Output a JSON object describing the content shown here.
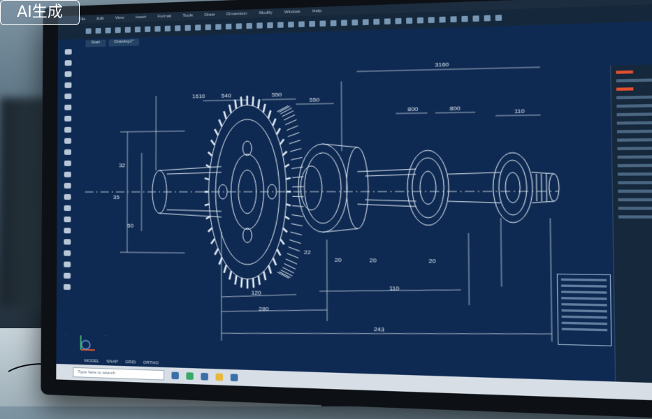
{
  "watermark": {
    "text": "AI生成"
  },
  "cad": {
    "menu": [
      "File",
      "Edit",
      "View",
      "Insert",
      "Format",
      "Tools",
      "Draw",
      "Dimension",
      "Modify",
      "Window",
      "Help"
    ],
    "tabs": [
      "Start",
      "Drawing1*"
    ],
    "taskbar_search_placeholder": "Type here to search",
    "status": [
      "MODEL",
      "SNAP",
      "GRID",
      "ORTHO"
    ],
    "dimensions": {
      "top_total": "3160",
      "gear_left_a": "1610",
      "gear_left_b": "540",
      "gear_mid": "550",
      "gear_right": "550",
      "mid_1": "800",
      "mid_2": "800",
      "mid_3": "110",
      "vert_1": "32",
      "vert_2": "35",
      "vert_3": "50",
      "bottom_1": "120",
      "bottom_2": "280",
      "bottom_3": "110",
      "bottom_4": "243",
      "bottom_5": "22",
      "small_1": "20",
      "small_2": "20",
      "small_3": "20"
    }
  },
  "colors": {
    "screen_bg": "#0f2a52",
    "line": "#dfe9f3",
    "accent_red": "#e0502e"
  }
}
